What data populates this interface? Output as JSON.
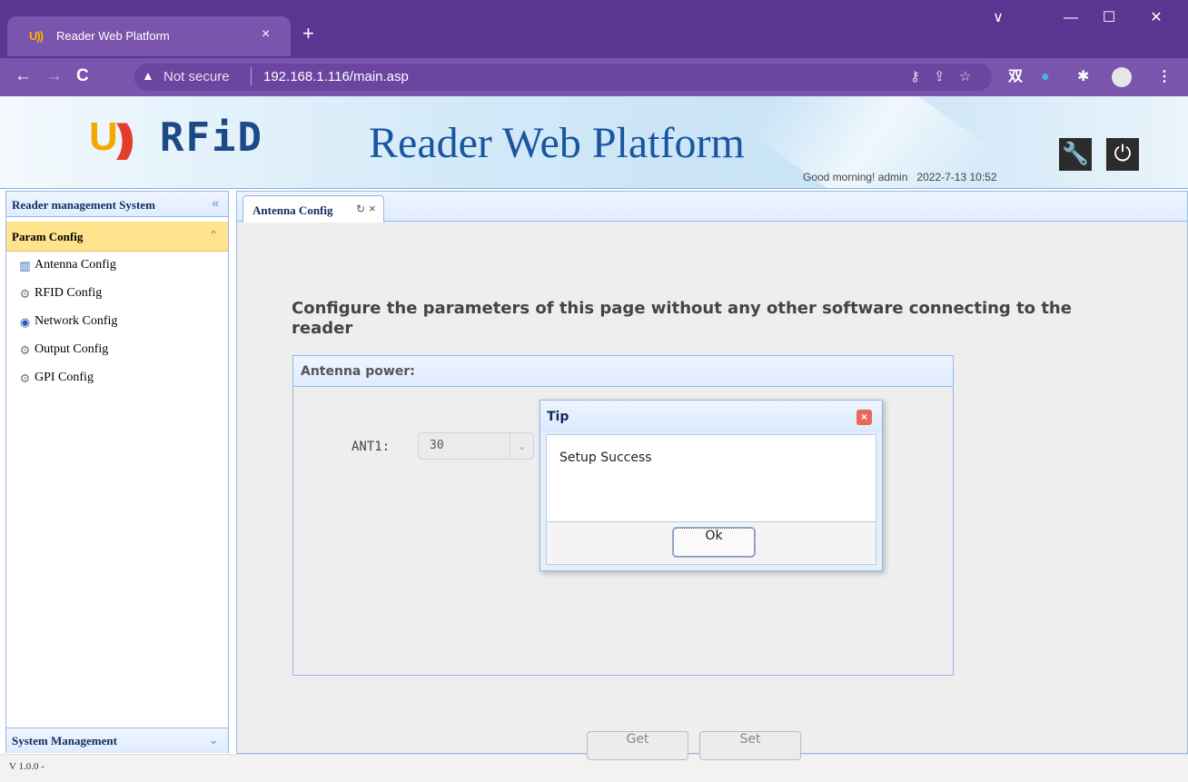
{
  "browser": {
    "tab_title": "Reader Web Platform",
    "tab_favicon_text": "U))",
    "tab_close": "×",
    "new_tab": "+",
    "window_controls": {
      "menu": "∨",
      "minimize": "—",
      "maximize": "☐",
      "close": "✕"
    },
    "nav": {
      "back": "←",
      "forward": "→",
      "reload": "C"
    },
    "security_label": "Not secure",
    "url": "192.168.1.116/main.asp",
    "omnibox_icons": [
      "key-icon",
      "share-icon",
      "star-icon"
    ],
    "extensions": {
      "translate": "双",
      "ext2": "●",
      "puzzle": "✱",
      "menu": "⋮"
    }
  },
  "header": {
    "logo_u": "U",
    "logo_waves": "))",
    "logo_rfid": "RFiD",
    "title": "Reader Web Platform",
    "greeting": "Good morning! admin",
    "datetime": "2022-7-13 10:52",
    "tools": {
      "settings_glyph": "🔧",
      "power_glyph": "⏻"
    }
  },
  "sidebar": {
    "title": "Reader management System",
    "collapse_glyph": "«",
    "section": {
      "title": "Param Config",
      "toggle_glyph": "⌃",
      "items": [
        {
          "label": "Antenna Config",
          "icon": "antenna-icon",
          "glyph": "▥"
        },
        {
          "label": "RFID Config",
          "icon": "gear-icon",
          "glyph": "⚙"
        },
        {
          "label": "Network Config",
          "icon": "network-icon",
          "glyph": "◉"
        },
        {
          "label": "Output Config",
          "icon": "gear-icon",
          "glyph": "⚙"
        },
        {
          "label": "GPI Config",
          "icon": "gear-icon",
          "glyph": "⚙"
        }
      ]
    },
    "footer_section": {
      "title": "System Management",
      "toggle_glyph": "⌄"
    },
    "version": "V 1.0.0 -"
  },
  "main": {
    "active_tab": {
      "label": "Antenna Config",
      "refresh_glyph": "↻",
      "close_glyph": "×"
    },
    "headline": "Configure the parameters of this page without any other software connecting to the reader",
    "antenna_power": {
      "title": "Antenna power:",
      "ant_label": "ANT1:",
      "ant_value": "30"
    },
    "buttons": {
      "get": "Get",
      "set": "Set"
    }
  },
  "dialog": {
    "title": "Tip",
    "close_glyph": "×",
    "message": "Setup Success",
    "ok_label": "Ok"
  },
  "colors": {
    "browser_frame": "#5a3592",
    "panel_border": "#95b8e7",
    "accordion_active": "#ffe48d",
    "header_title": "#1a56a0"
  }
}
